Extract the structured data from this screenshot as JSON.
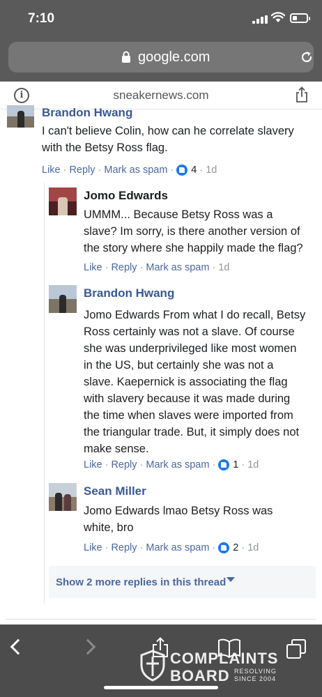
{
  "status_bar": {
    "time": "7:10"
  },
  "browser": {
    "url": "google.com",
    "site": "sneakernews.com"
  },
  "comments": [
    {
      "author": "Brandon Hwang",
      "text_lines": [
        "I can't believe Colin, how can he correlate slavery",
        "with the Betsy Ross flag."
      ],
      "actions": {
        "like": "Like",
        "reply": "Reply",
        "spam": "Mark as spam",
        "reactions": "4",
        "time": "1d"
      }
    },
    {
      "author": "Jomo Edwards",
      "text_lines": [
        "UMMM... Because Betsy Ross was a",
        "slave? Im sorry, is there another version of",
        "the story where she happily made the flag?"
      ],
      "actions": {
        "like": "Like",
        "reply": "Reply",
        "spam": "Mark as spam",
        "time": "1d"
      }
    },
    {
      "author": "Brandon Hwang",
      "text_lines": [
        "Jomo Edwards From what I do recall, Betsy",
        "Ross certainly was not a slave. Of course",
        "she was underprivileged like most women",
        "in the US, but certainly she was not a",
        "slave. Kaepernick is associating the flag",
        "with slavery because it was made during",
        "the time when slaves were imported from",
        "the triangular trade. But, it simply does not",
        "make sense."
      ],
      "actions": {
        "like": "Like",
        "reply": "Reply",
        "spam": "Mark as spam",
        "reactions": "1",
        "time": "1d"
      }
    },
    {
      "author": "Sean Miller",
      "text_lines": [
        "Jomo Edwards lmao Betsy Ross was",
        "white, bro"
      ],
      "actions": {
        "like": "Like",
        "reply": "Reply",
        "spam": "Mark as spam",
        "reactions": "2",
        "time": "1d"
      }
    }
  ],
  "more_replies": "Show 2 more replies in this thread",
  "watermark": {
    "line1": "COMPLAINTS",
    "line2": "BOARD",
    "tag1": "RESOLVING",
    "tag2": "SINCE 2004"
  },
  "colors": {
    "link": "#385898",
    "action": "#4b67a1",
    "chrome": "#5a5a5a",
    "toolbar": "#4c4c4c"
  }
}
